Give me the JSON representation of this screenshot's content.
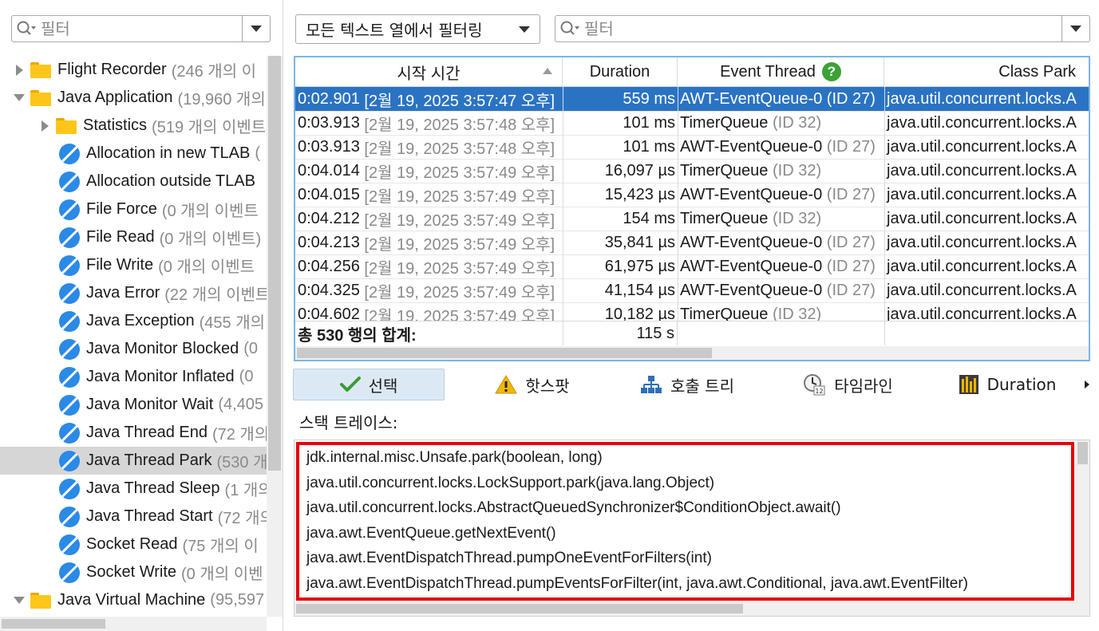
{
  "left_filter": {
    "placeholder": "필터"
  },
  "tree": [
    {
      "name": "Flight Recorder",
      "count": "(246 개의 이",
      "type": "folder",
      "expander": "collapsed",
      "indent": 0
    },
    {
      "name": "Java Application",
      "count": "(19,960 개의",
      "type": "folder",
      "expander": "expanded",
      "indent": 0
    },
    {
      "name": "Statistics",
      "count": "(519 개의 이벤트",
      "type": "folder",
      "expander": "collapsed",
      "indent": 1
    },
    {
      "name": "Allocation in new TLAB",
      "count": "(",
      "type": "event",
      "indent": 1
    },
    {
      "name": "Allocation outside TLAB",
      "count": "",
      "type": "event",
      "indent": 1
    },
    {
      "name": "File Force",
      "count": "(0 개의 이벤트",
      "type": "event",
      "indent": 1
    },
    {
      "name": "File Read",
      "count": "(0 개의 이벤트)",
      "type": "event",
      "indent": 1
    },
    {
      "name": "File Write",
      "count": "(0 개의 이벤트",
      "type": "event",
      "indent": 1
    },
    {
      "name": "Java Error",
      "count": "(22 개의 이벤트",
      "type": "event",
      "indent": 1
    },
    {
      "name": "Java Exception",
      "count": "(455 개의",
      "type": "event",
      "indent": 1
    },
    {
      "name": "Java Monitor Blocked",
      "count": "(0",
      "type": "event",
      "indent": 1
    },
    {
      "name": "Java Monitor Inflated",
      "count": "(0",
      "type": "event",
      "indent": 1
    },
    {
      "name": "Java Monitor Wait",
      "count": "(4,405",
      "type": "event",
      "indent": 1
    },
    {
      "name": "Java Thread End",
      "count": "(72 개의",
      "type": "event",
      "indent": 1
    },
    {
      "name": "Java Thread Park",
      "count": "(530 개",
      "type": "event",
      "indent": 1,
      "selected": true
    },
    {
      "name": "Java Thread Sleep",
      "count": "(1 개의",
      "type": "event",
      "indent": 1
    },
    {
      "name": "Java Thread Start",
      "count": "(72 개의",
      "type": "event",
      "indent": 1
    },
    {
      "name": "Socket Read",
      "count": "(75 개의 이",
      "type": "event",
      "indent": 1
    },
    {
      "name": "Socket Write",
      "count": "(0 개의 이벤",
      "type": "event",
      "indent": 1
    },
    {
      "name": "Java Virtual Machine",
      "count": "(95,597",
      "type": "folder",
      "expander": "expanded",
      "indent": 0
    }
  ],
  "column_filter": {
    "label": "모든 텍스트 열에서 필터링"
  },
  "right_filter": {
    "placeholder": "필터"
  },
  "table": {
    "headers": {
      "start_time": "시작 시간",
      "duration": "Duration",
      "event_thread": "Event Thread",
      "class_park": "Class Park"
    },
    "rows": [
      {
        "time": "0:02.901",
        "date": "[2월 19, 2025 3:57:47 오후]",
        "duration": "559 ms",
        "thread": "AWT-EventQueue-0",
        "tid": "(ID 27)",
        "cls": "java.util.concurrent.locks.A"
      },
      {
        "time": "0:03.913",
        "date": "[2월 19, 2025 3:57:48 오후]",
        "duration": "101 ms",
        "thread": "TimerQueue",
        "tid": "(ID 32)",
        "cls": "java.util.concurrent.locks.A"
      },
      {
        "time": "0:03.913",
        "date": "[2월 19, 2025 3:57:48 오후]",
        "duration": "101 ms",
        "thread": "AWT-EventQueue-0",
        "tid": "(ID 27)",
        "cls": "java.util.concurrent.locks.A"
      },
      {
        "time": "0:04.014",
        "date": "[2월 19, 2025 3:57:49 오후]",
        "duration": "16,097 µs",
        "thread": "TimerQueue",
        "tid": "(ID 32)",
        "cls": "java.util.concurrent.locks.A"
      },
      {
        "time": "0:04.015",
        "date": "[2월 19, 2025 3:57:49 오후]",
        "duration": "15,423 µs",
        "thread": "AWT-EventQueue-0",
        "tid": "(ID 27)",
        "cls": "java.util.concurrent.locks.A"
      },
      {
        "time": "0:04.212",
        "date": "[2월 19, 2025 3:57:49 오후]",
        "duration": "154 ms",
        "thread": "TimerQueue",
        "tid": "(ID 32)",
        "cls": "java.util.concurrent.locks.A"
      },
      {
        "time": "0:04.213",
        "date": "[2월 19, 2025 3:57:49 오후]",
        "duration": "35,841 µs",
        "thread": "AWT-EventQueue-0",
        "tid": "(ID 27)",
        "cls": "java.util.concurrent.locks.A"
      },
      {
        "time": "0:04.256",
        "date": "[2월 19, 2025 3:57:49 오후]",
        "duration": "61,975 µs",
        "thread": "AWT-EventQueue-0",
        "tid": "(ID 27)",
        "cls": "java.util.concurrent.locks.A"
      },
      {
        "time": "0:04.325",
        "date": "[2월 19, 2025 3:57:49 오후]",
        "duration": "41,154 µs",
        "thread": "AWT-EventQueue-0",
        "tid": "(ID 27)",
        "cls": "java.util.concurrent.locks.A"
      },
      {
        "time": "0:04.602",
        "date": "[2월 19, 2025 3:57:49 오후]",
        "duration": "10,182 µs",
        "thread": "TimerQueue",
        "tid": "(ID 32)",
        "cls": "java.util.concurrent.locks.A"
      }
    ],
    "footer": {
      "label": "총 530 행의 합계:",
      "duration_total": "115 s"
    }
  },
  "tabs": [
    {
      "label": "선택",
      "icon": "checkmark-icon",
      "active": true
    },
    {
      "label": "핫스팟",
      "icon": "warning-icon"
    },
    {
      "label": "호출 트리",
      "icon": "hierarchy-icon"
    },
    {
      "label": "타임라인",
      "icon": "calendar-clock-icon"
    },
    {
      "label": "Duration",
      "icon": "bar-chart-icon"
    }
  ],
  "stack": {
    "label": "스택 트레이스:",
    "lines": [
      "jdk.internal.misc.Unsafe.park(boolean, long)",
      "java.util.concurrent.locks.LockSupport.park(java.lang.Object)",
      "java.util.concurrent.locks.AbstractQueuedSynchronizer$ConditionObject.await()",
      "java.awt.EventQueue.getNextEvent()",
      "java.awt.EventDispatchThread.pumpOneEventForFilters(int)",
      "java.awt.EventDispatchThread.pumpEventsForFilter(int, java.awt.Conditional, java.awt.EventFilter)"
    ]
  },
  "colors": {
    "selection": "#2a73c3",
    "accent_border": "#7eb4ea",
    "highlight_box": "#e8000b",
    "folder": "#ffc61a",
    "event_icon": "#2a8ae6"
  }
}
